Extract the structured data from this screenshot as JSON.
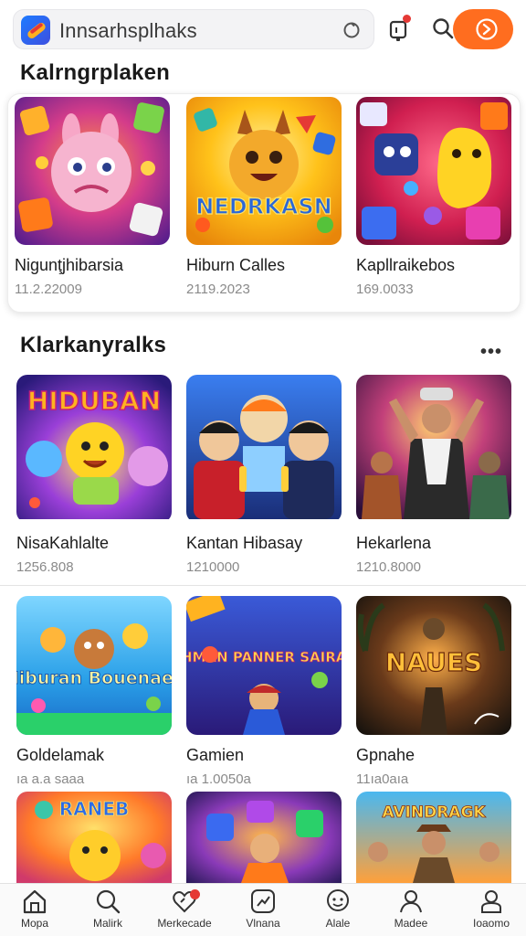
{
  "search": {
    "text": "Innsarhsplhaks",
    "logo_icon": "app-logo-icon",
    "search_icon": "search-circle-icon"
  },
  "header": {
    "bell_icon": "notification-icon",
    "search_icon": "search-icon",
    "go_icon": "arrow-right-circle-icon",
    "accent": "#ff6d1f"
  },
  "sections": [
    {
      "title": "Kalrngrplaken",
      "cards": [
        {
          "title": "Nigunţjhibarsia",
          "sub": "11.2.22009"
        },
        {
          "title": "Hiburn Calles",
          "sub": "2119.2023"
        },
        {
          "title": "Kapllraikebos",
          "sub": "169.0033"
        }
      ]
    },
    {
      "title": "Klarkanyralks",
      "more_label": "•••",
      "cards": [
        {
          "title": "NisaKahlalte",
          "sub": "1256.808"
        },
        {
          "title": "Kantan Hibasay",
          "sub": "1210000"
        },
        {
          "title": "Hekarlena",
          "sub": "1210.8000"
        }
      ]
    },
    {
      "cards": [
        {
          "title": "Goldelamak",
          "sub": "ıa a.a saaa",
          "thumb_text": "Hiburan Bouenaes"
        },
        {
          "title": "Gamien",
          "sub": "ıa 1.0050a",
          "thumb_text": "NLSHMAN PANNER SAIRANES"
        },
        {
          "title": "Gpnahe",
          "sub": "11ıa0aıa",
          "thumb_text": "NAUES"
        }
      ]
    },
    {
      "cards": [
        {
          "thumb_text": "RANEB"
        },
        {
          "thumb_text": ""
        },
        {
          "thumb_text": "AVINDRAGK"
        }
      ]
    }
  ],
  "card_row2_thumb_text": "HIDUBAN",
  "card_row1_thumb_text": "NEDRKASN",
  "bottom_nav": [
    {
      "label": "Mopa",
      "icon": "home-icon"
    },
    {
      "label": "Malirk",
      "icon": "search-icon"
    },
    {
      "label": "Merkecade",
      "icon": "heart-icon",
      "badge": true
    },
    {
      "label": "Vlnana",
      "icon": "game-icon"
    },
    {
      "label": "Alale",
      "icon": "chat-face-icon"
    },
    {
      "label": "Madee",
      "icon": "person-icon"
    },
    {
      "label": "Ioaomo",
      "icon": "profile-icon"
    }
  ]
}
